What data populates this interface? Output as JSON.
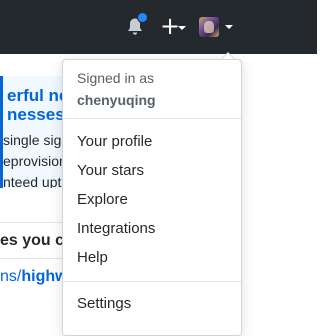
{
  "header": {
    "notification_icon": "bell-icon",
    "create_icon": "plus-icon",
    "create_glyph": "+",
    "avatar_icon": "user-avatar",
    "colors": {
      "bar": "#24292e",
      "notification_dot": "#2188ff"
    }
  },
  "background": {
    "banner_headline_1": "erful new",
    "banner_headline_2": "nesses o",
    "banner_line_1": "single sign",
    "banner_line_2": "eprovisionin",
    "banner_line_3": "nteed uptim",
    "section_heading": "es you co",
    "repo_prefix": "ns/",
    "repo_name": "highwa"
  },
  "menu": {
    "signed_in_label": "Signed in as",
    "username": "chenyuqing",
    "items": [
      {
        "label": "Your profile"
      },
      {
        "label": "Your stars"
      },
      {
        "label": "Explore"
      },
      {
        "label": "Integrations"
      },
      {
        "label": "Help"
      },
      {
        "label": "Settings"
      }
    ]
  }
}
